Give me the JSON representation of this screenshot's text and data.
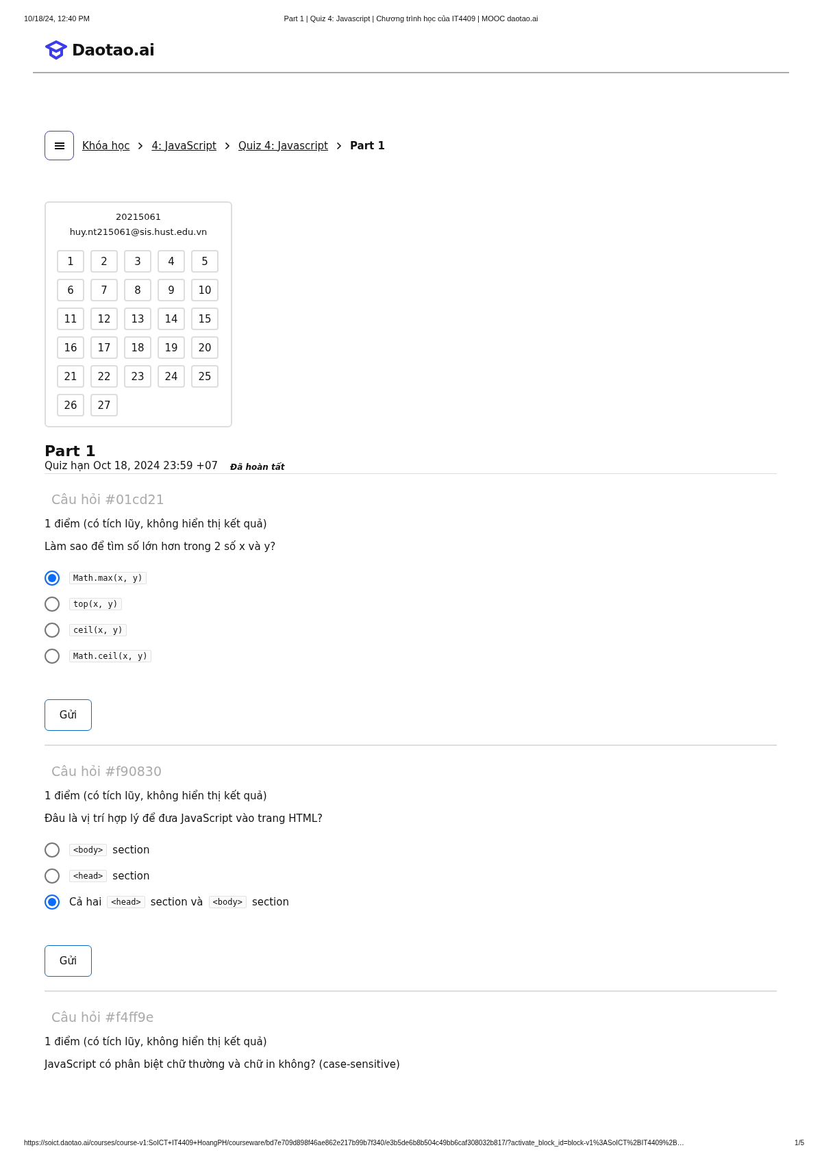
{
  "print_header": {
    "date": "10/18/24, 12:40 PM",
    "title": "Part 1 | Quiz 4: Javascript | Chương trình học của IT4409 | MOOC daotao.ai"
  },
  "logo": {
    "text": "Daotao.ai"
  },
  "breadcrumb": [
    {
      "label": "Khóa học",
      "kind": "link"
    },
    {
      "label": "4: JavaScript",
      "kind": "link"
    },
    {
      "label": "Quiz 4: Javascript",
      "kind": "link"
    },
    {
      "label": "Part 1",
      "kind": "current"
    }
  ],
  "quiz_nav": {
    "student_id": "20215061",
    "email": "huy.nt215061@sis.hust.edu.vn",
    "numbers": [
      "1",
      "2",
      "3",
      "4",
      "5",
      "6",
      "7",
      "8",
      "9",
      "10",
      "11",
      "12",
      "13",
      "14",
      "15",
      "16",
      "17",
      "18",
      "19",
      "20",
      "21",
      "22",
      "23",
      "24",
      "25",
      "26",
      "27"
    ]
  },
  "part": {
    "title": "Part 1",
    "due": "Quiz hạn Oct 18, 2024 23:59 +07",
    "status": "Đã hoàn tất"
  },
  "questions": [
    {
      "header": "Câu hỏi #01cd21",
      "points": "1 điểm (có tích lũy, không hiển thị kết quả)",
      "text": "Làm sao để tìm số lớn hơn trong 2 số x và y?",
      "options": [
        {
          "selected": true,
          "parts": [
            {
              "kind": "code",
              "text": "Math.max(x, y)"
            }
          ]
        },
        {
          "selected": false,
          "parts": [
            {
              "kind": "code",
              "text": "top(x, y)"
            }
          ]
        },
        {
          "selected": false,
          "parts": [
            {
              "kind": "code",
              "text": "ceil(x, y)"
            }
          ]
        },
        {
          "selected": false,
          "parts": [
            {
              "kind": "code",
              "text": "Math.ceil(x, y)"
            }
          ]
        }
      ],
      "submit": "Gửi"
    },
    {
      "header": "Câu hỏi #f90830",
      "points": "1 điểm (có tích lũy, không hiển thị kết quả)",
      "text": "Đâu là vị trí hợp lý để đưa JavaScript vào trang HTML?",
      "options": [
        {
          "selected": false,
          "parts": [
            {
              "kind": "code",
              "text": "<body>"
            },
            {
              "kind": "text",
              "text": "section"
            }
          ]
        },
        {
          "selected": false,
          "parts": [
            {
              "kind": "code",
              "text": "<head>"
            },
            {
              "kind": "text",
              "text": "section"
            }
          ]
        },
        {
          "selected": true,
          "parts": [
            {
              "kind": "text",
              "text": "Cả hai"
            },
            {
              "kind": "code",
              "text": "<head>"
            },
            {
              "kind": "text",
              "text": "section và"
            },
            {
              "kind": "code",
              "text": "<body>"
            },
            {
              "kind": "text",
              "text": "section"
            }
          ]
        }
      ],
      "submit": "Gửi"
    },
    {
      "header": "Câu hỏi #f4ff9e",
      "points": "1 điểm (có tích lũy, không hiển thị kết quả)",
      "text": "JavaScript có phân biệt chữ thường và chữ in không? (case-sensitive)"
    }
  ],
  "print_footer": {
    "url": "https://soict.daotao.ai/courses/course-v1:SoICT+IT4409+HoangPH/courseware/bd7e709d898f46ae862e217b99b7f340/e3b5de6b8b504c49bb6caf308032b817/?activate_block_id=block-v1%3ASoICT%2BIT4409%2B…",
    "page": "1/5"
  }
}
